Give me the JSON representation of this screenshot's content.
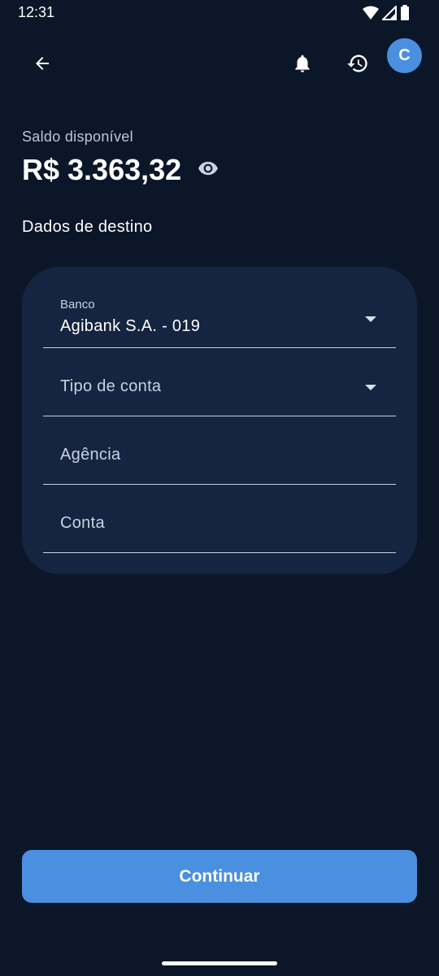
{
  "status_bar": {
    "time": "12:31",
    "icons": [
      "wifi-icon",
      "signal-icon",
      "battery-icon"
    ]
  },
  "toolbar": {
    "back_icon": "arrow-back-icon",
    "notifications_icon": "bell-icon",
    "history_icon": "history-icon",
    "avatar_initial": "C"
  },
  "balance": {
    "label": "Saldo disponível",
    "value": "R$ 3.363,32",
    "visibility_icon": "eye-icon"
  },
  "section": {
    "title": "Dados de destino"
  },
  "form": {
    "bank": {
      "label": "Banco",
      "value": "Agibank S.A. - 019"
    },
    "account_type": {
      "placeholder": "Tipo de conta"
    },
    "agency": {
      "placeholder": "Agência"
    },
    "account": {
      "placeholder": "Conta"
    }
  },
  "actions": {
    "continue_label": "Continuar"
  },
  "colors": {
    "background": "#0b1628",
    "card": "#152440",
    "accent": "#4a8fe0",
    "muted_text": "#c8d2e2"
  }
}
